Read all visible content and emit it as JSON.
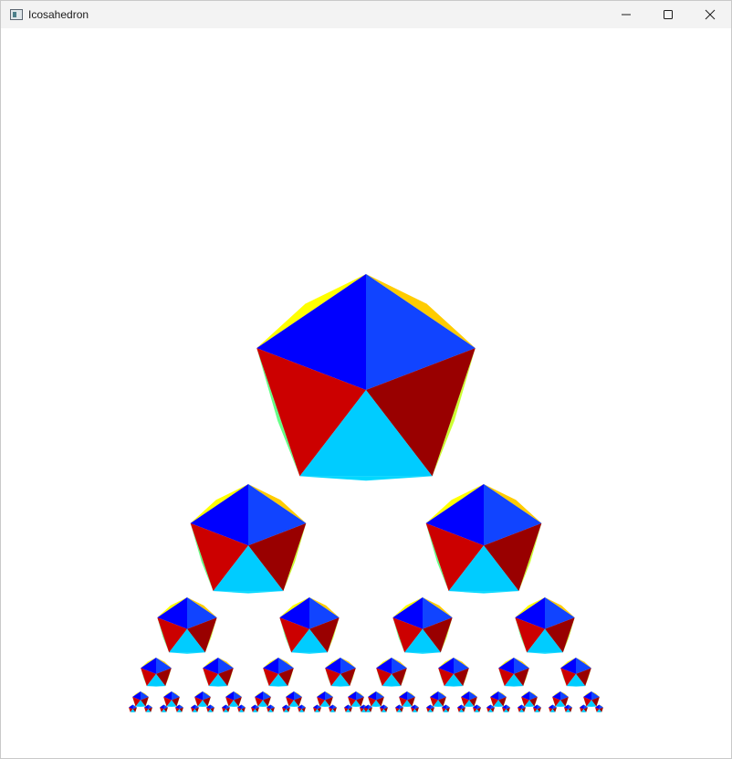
{
  "window": {
    "title": "Icosahedron",
    "app_icon": "window-app-icon"
  },
  "controls": {
    "minimize_icon": "minimize-icon",
    "maximize_icon": "maximize-icon",
    "close_icon": "close-icon"
  },
  "scene": {
    "background": "#ffffff",
    "fractal": "sierpinski-triangle-of-icosahedra",
    "levels": 6,
    "face_colors": {
      "top": "#0000ff",
      "top_right": "#1144ff",
      "lower_left": "#cc0000",
      "lower_right": "#990000",
      "bottom": "#00ccff",
      "edge_yellow": "#ffff00",
      "edge_orange": "#ffcc00",
      "edge_lime": "#ccff33",
      "edge_green": "#66ff88"
    }
  }
}
